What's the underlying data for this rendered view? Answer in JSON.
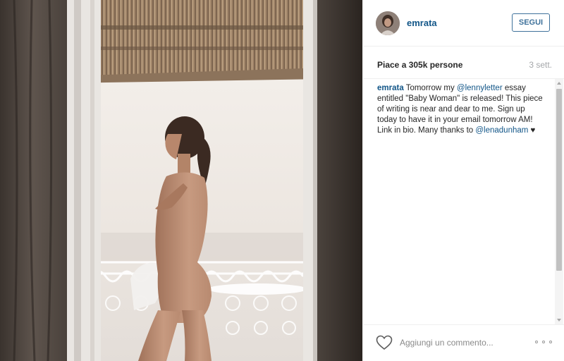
{
  "post": {
    "username": "emrata",
    "follow_label": "SEGUI",
    "likes_text": "Piace a 305k persone",
    "time_text": "3 sett.",
    "caption": {
      "user": "emrata",
      "text_1": " Tomorrow my ",
      "mention_1": "@lennyletter",
      "text_2": " essay entitled \"Baby Woman\" is released! This piece of writing is near and dear to me. Sign up today to have it in your email tomorrow AM! Link in bio. Many thanks to ",
      "mention_2": "@lenadunham",
      "emoji": " ♥"
    },
    "comment_placeholder": "Aggiungi un commento...",
    "more_label": "..."
  },
  "icons": {
    "heart": "heart-icon",
    "more": "more-options-icon",
    "avatar": "avatar"
  },
  "colors": {
    "link": "#125688",
    "follow": "#3f729b",
    "muted": "#a5a7aa"
  }
}
